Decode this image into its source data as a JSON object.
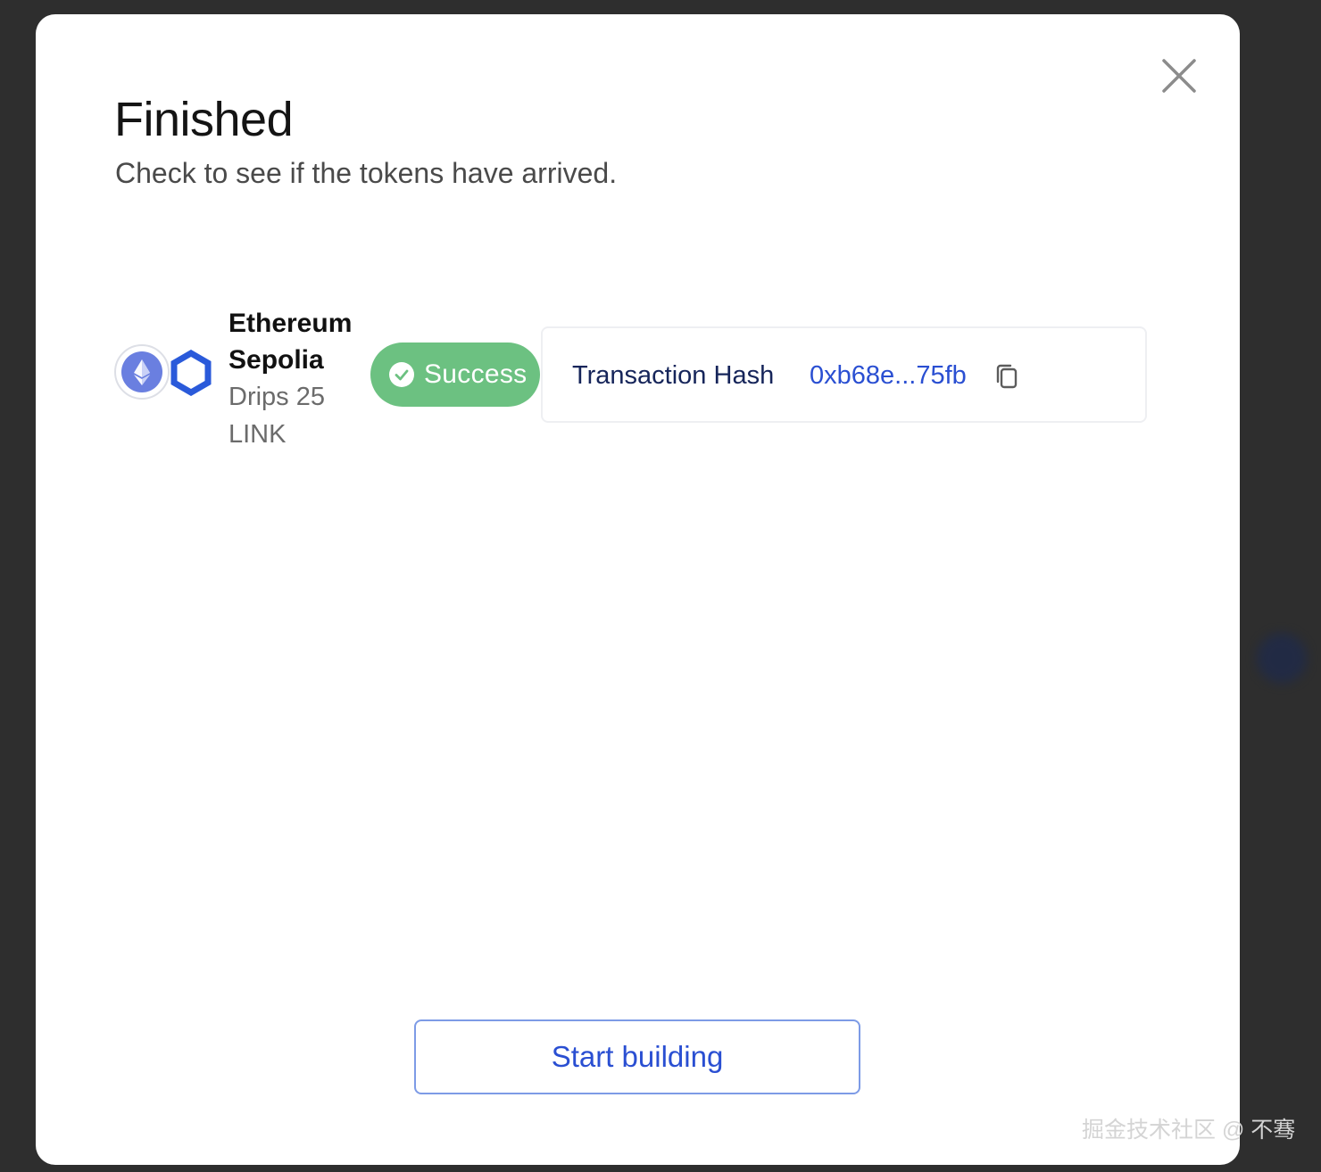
{
  "modal": {
    "title": "Finished",
    "subtitle": "Check to see if the tokens have arrived."
  },
  "network": {
    "name": "Ethereum Sepolia",
    "drips_text": "Drips 25 LINK",
    "primary_icon": "ethereum-icon",
    "secondary_icon": "chainlink-icon"
  },
  "status": {
    "label": "Success",
    "icon": "check-circle-icon",
    "color": "#6cc181"
  },
  "transaction": {
    "label": "Transaction Hash",
    "hash": "0xb68e...75fb",
    "copy_icon": "copy-icon"
  },
  "actions": {
    "start_label": "Start building"
  },
  "watermark": "掘金技术社区 @ 不骞",
  "colors": {
    "accent": "#2a4fd2",
    "navy_text": "#16255a",
    "success": "#6cc181",
    "ethereum": "#6a7fe0",
    "chainlink": "#2a5ada",
    "backdrop": "#2e2e2e"
  }
}
